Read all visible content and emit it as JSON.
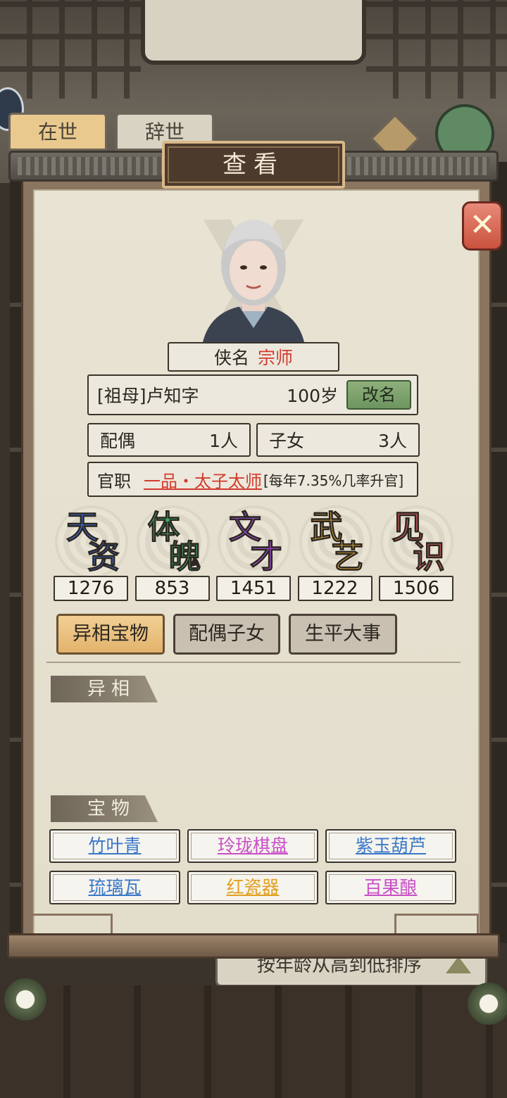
{
  "background": {
    "tabs": [
      "在世",
      "辞世"
    ],
    "sort_label": "按年龄从高到低排序"
  },
  "dialog": {
    "title": "查看",
    "close_icon": "close-x-icon"
  },
  "character": {
    "name_label": "侠名",
    "title": "宗师",
    "identity": "[祖母]卢知字",
    "age": "100岁",
    "rename_label": "改名",
    "spouse_label": "配偶",
    "spouse_count": "1人",
    "children_label": "子女",
    "children_count": "3人",
    "office_label": "官职",
    "office_title": "一品・太子太师",
    "office_chance": "[每年7.35%几率升官]"
  },
  "stats": [
    {
      "chars": [
        "天",
        "资"
      ],
      "value": "1276",
      "color": "#3f6fd8"
    },
    {
      "chars": [
        "体",
        "魄"
      ],
      "value": "853",
      "color": "#3fb06a"
    },
    {
      "chars": [
        "文",
        "才"
      ],
      "value": "1451",
      "color": "#a24fd1"
    },
    {
      "chars": [
        "武",
        "艺"
      ],
      "value": "1222",
      "color": "#e0a93a"
    },
    {
      "chars": [
        "见",
        "识"
      ],
      "value": "1506",
      "color": "#d9605a"
    }
  ],
  "tabs": [
    "异相宝物",
    "配偶子女",
    "生平大事"
  ],
  "active_tab": 0,
  "sections": {
    "traits_label": "异相",
    "treasures_label": "宝物"
  },
  "treasures": [
    {
      "name": "竹叶青",
      "color": "#3a78c8"
    },
    {
      "name": "玲珑棋盘",
      "color": "#c84fc8"
    },
    {
      "name": "紫玉葫芦",
      "color": "#3a78c8"
    },
    {
      "name": "琉璃瓦",
      "color": "#3a78c8"
    },
    {
      "name": "红瓷器",
      "color": "#e0a020"
    },
    {
      "name": "百果酿",
      "color": "#c84fc8"
    }
  ]
}
